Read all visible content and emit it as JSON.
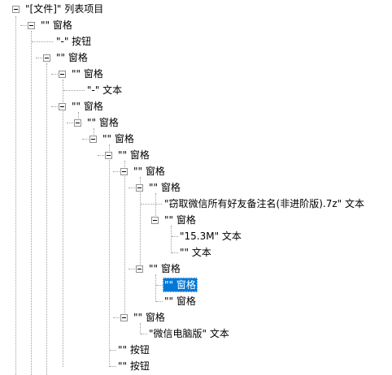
{
  "tree": {
    "nodes": [
      {
        "id": "n0",
        "text": "\"[文件]\" 列表项目",
        "expanded": true,
        "selected": false
      },
      {
        "id": "n1",
        "text": "\"\" 窗格",
        "expanded": true,
        "selected": false
      },
      {
        "id": "n2",
        "text": "\"-\" 按钮",
        "expanded": null,
        "selected": false
      },
      {
        "id": "n3",
        "text": "\"\" 窗格",
        "expanded": true,
        "selected": false
      },
      {
        "id": "n4",
        "text": "\"\" 窗格",
        "expanded": true,
        "selected": false
      },
      {
        "id": "n5",
        "text": "\"-\" 文本",
        "expanded": null,
        "selected": false
      },
      {
        "id": "n6",
        "text": "\"\" 窗格",
        "expanded": true,
        "selected": false
      },
      {
        "id": "n7",
        "text": "\"\" 窗格",
        "expanded": true,
        "selected": false
      },
      {
        "id": "n8",
        "text": "\"\" 窗格",
        "expanded": true,
        "selected": false
      },
      {
        "id": "n9",
        "text": "\"\" 窗格",
        "expanded": true,
        "selected": false
      },
      {
        "id": "n10",
        "text": "\"\" 窗格",
        "expanded": true,
        "selected": false
      },
      {
        "id": "n11",
        "text": "\"\" 窗格",
        "expanded": true,
        "selected": false
      },
      {
        "id": "n12",
        "text": "\"窃取微信所有好友备注名(非进阶版).7z\" 文本",
        "expanded": null,
        "selected": false
      },
      {
        "id": "n13",
        "text": "\"\" 窗格",
        "expanded": true,
        "selected": false
      },
      {
        "id": "n14",
        "text": "\"15.3M\" 文本",
        "expanded": null,
        "selected": false
      },
      {
        "id": "n15",
        "text": "\"\" 文本",
        "expanded": null,
        "selected": false
      },
      {
        "id": "n16",
        "text": "\"\" 窗格",
        "expanded": true,
        "selected": false
      },
      {
        "id": "n17",
        "text": "\"\" 窗格",
        "expanded": null,
        "selected": true
      },
      {
        "id": "n18",
        "text": "\"\" 窗格",
        "expanded": null,
        "selected": false
      },
      {
        "id": "n19",
        "text": "\"\" 窗格",
        "expanded": true,
        "selected": false
      },
      {
        "id": "n20",
        "text": "\"微信电脑版\" 文本",
        "expanded": null,
        "selected": false
      },
      {
        "id": "n21",
        "text": "\"\" 按钮",
        "expanded": null,
        "selected": false
      },
      {
        "id": "n22",
        "text": "\"\" 按钮",
        "expanded": null,
        "selected": false
      }
    ],
    "colors": {
      "selection_bg": "#0078d7",
      "selection_fg": "#ffffff",
      "connector": "#a0a0a0",
      "toggle_border": "#919191"
    }
  }
}
